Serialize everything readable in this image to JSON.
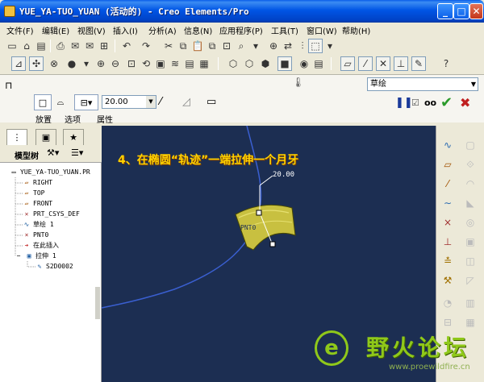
{
  "window": {
    "title": "YUE_YA-TUO_YUAN (活动的) - Creo Elements/Pro",
    "min_glyph": "_",
    "max_glyph": "□",
    "close_glyph": "✕"
  },
  "menubar": [
    {
      "label": "文件(F)"
    },
    {
      "label": "编辑(E)"
    },
    {
      "label": "视图(V)"
    },
    {
      "label": "插入(I)"
    },
    {
      "label": "分析(A)"
    },
    {
      "label": "信息(N)"
    },
    {
      "label": "应用程序(P)"
    },
    {
      "label": "工具(T)"
    },
    {
      "label": "窗口(W)"
    },
    {
      "label": "帮助(H)"
    }
  ],
  "dashboard": {
    "depth_value": "20.00",
    "type_select": "草绘",
    "labels": {
      "placement": "放置",
      "options": "选项",
      "properties": "属性"
    }
  },
  "model_tree": {
    "header": "模型树",
    "items": [
      {
        "label": "YUE_YA-TUO_YUAN.PR",
        "icon": "part-icon"
      },
      {
        "label": "RIGHT",
        "icon": "datum-plane-icon"
      },
      {
        "label": "TOP",
        "icon": "datum-plane-icon"
      },
      {
        "label": "FRONT",
        "icon": "datum-plane-icon"
      },
      {
        "label": "PRT_CSYS_DEF",
        "icon": "csys-icon"
      },
      {
        "label": "草绘 1",
        "icon": "sketch-icon"
      },
      {
        "label": "PNT0",
        "icon": "datum-point-icon"
      },
      {
        "label": "在此插入",
        "icon": "insert-here-icon"
      },
      {
        "label": "拉伸 1",
        "icon": "extrude-icon"
      },
      {
        "label": "S2D0002",
        "icon": "section-icon"
      }
    ]
  },
  "viewport": {
    "annotation": "4、在椭圆“轨迹”一端拉伸一个月牙",
    "dimension_label": "20.00",
    "point_label": "PNT0",
    "colors": {
      "background": "#1c2e52",
      "curve": "#3a5fd0",
      "surface": "#c8c040"
    }
  },
  "watermark": {
    "name": "野火论坛",
    "url": "www.proewildfire.cn"
  }
}
